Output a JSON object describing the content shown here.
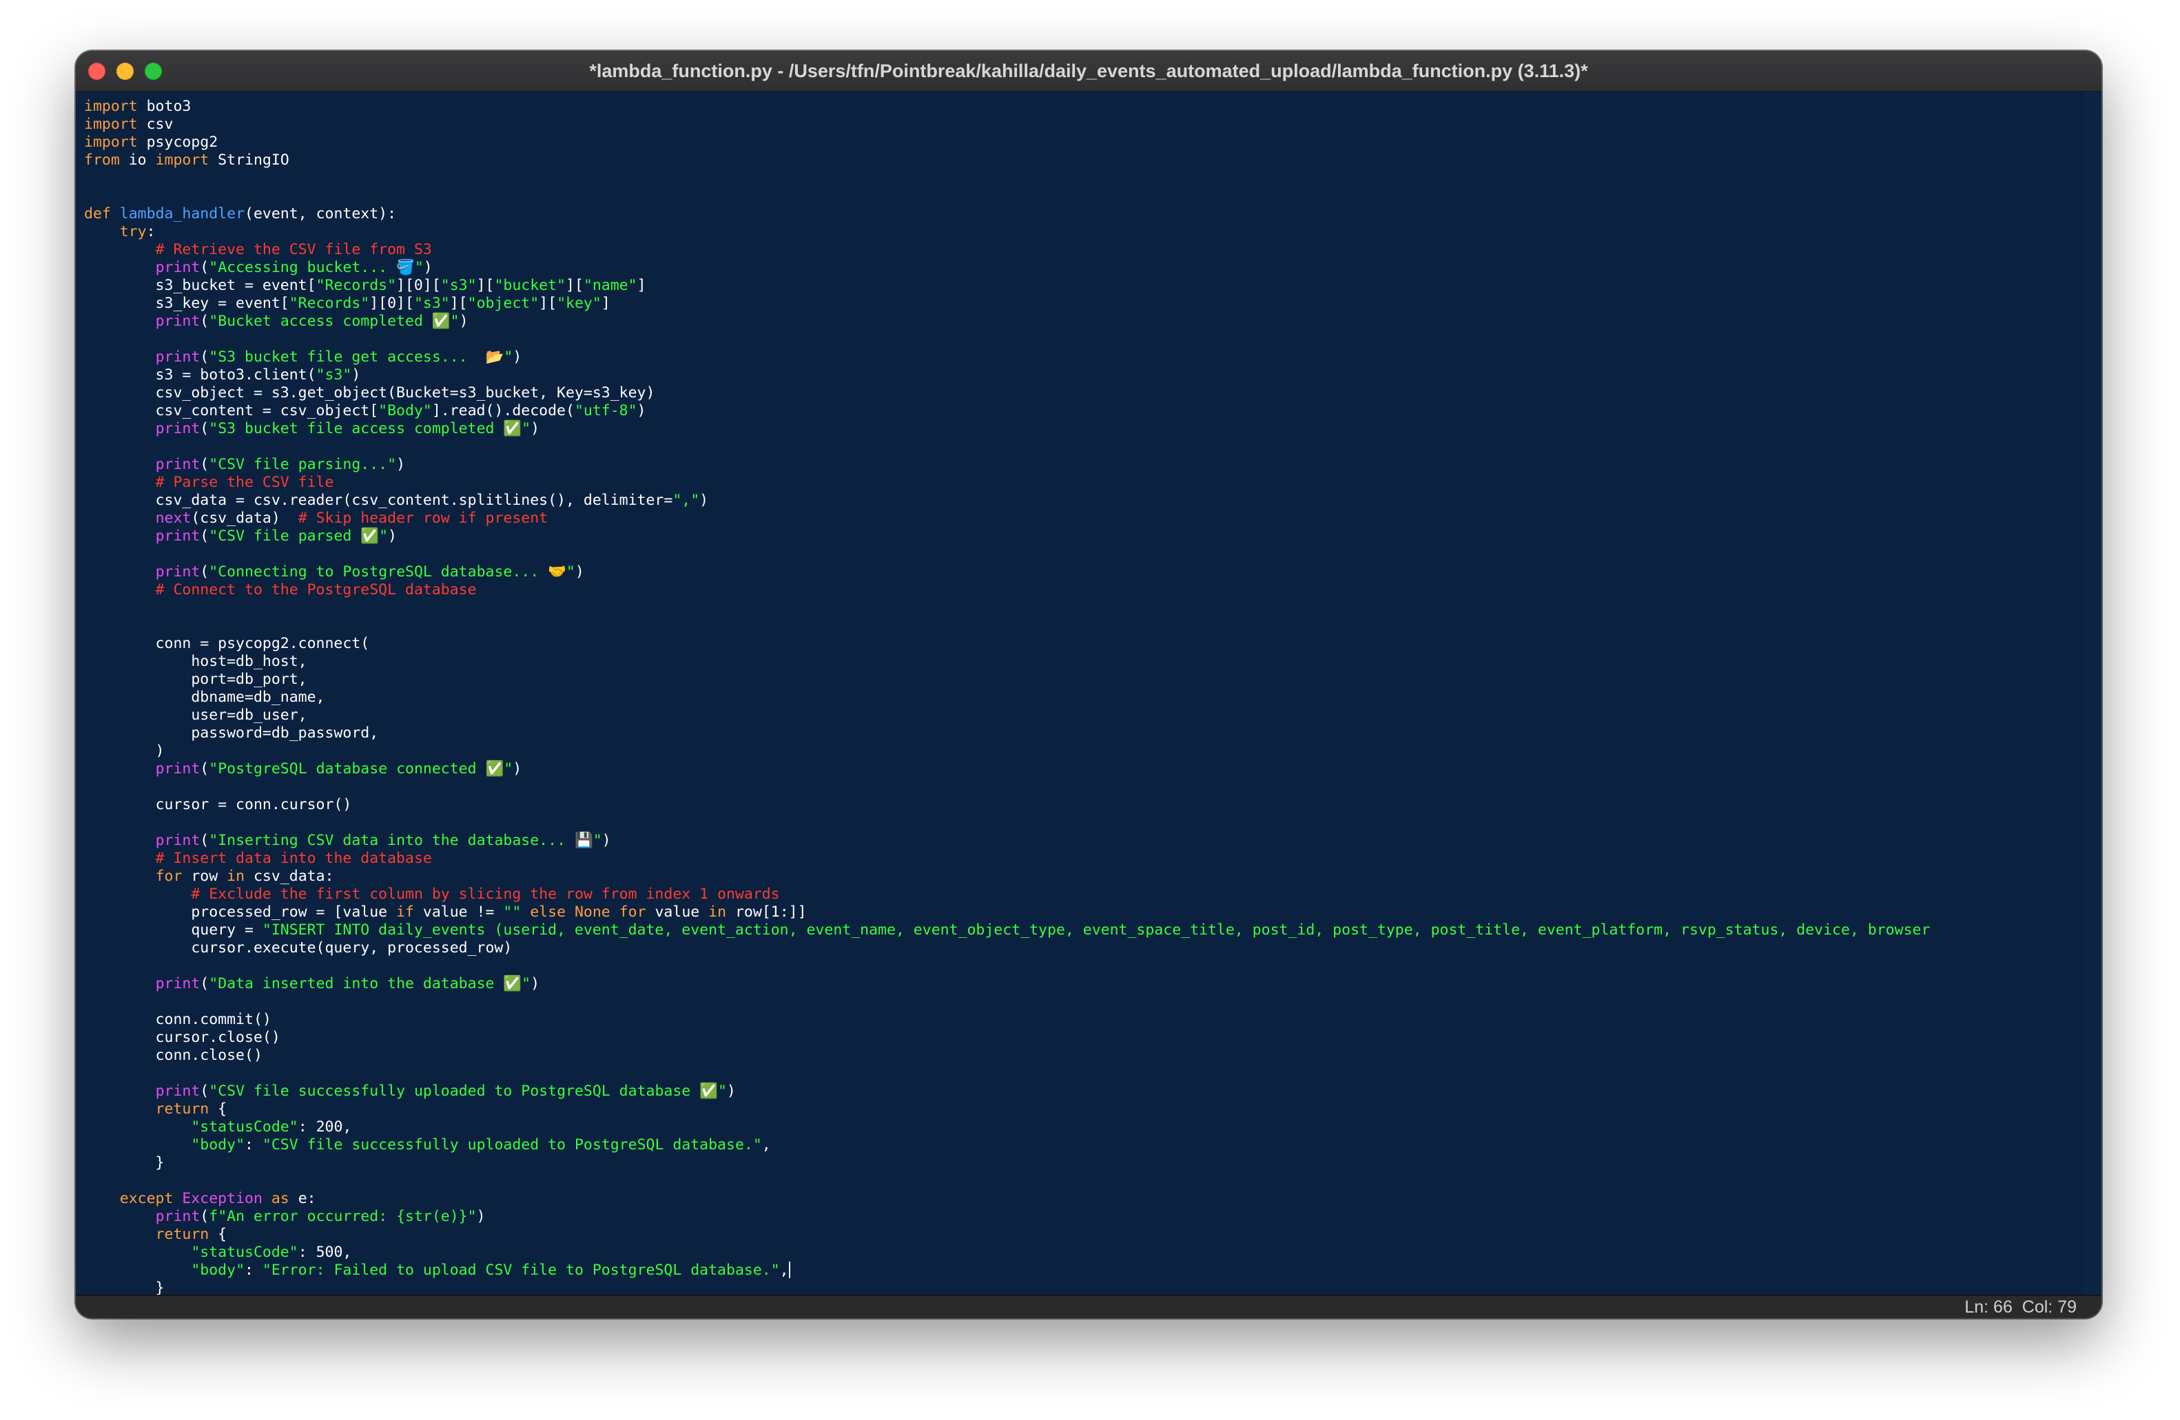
{
  "window": {
    "title": "*lambda_function.py - /Users/tfn/Pointbreak/kahilla/daily_events_automated_upload/lambda_function.py (3.11.3)*"
  },
  "status": {
    "ln": "Ln: 66",
    "col": "Col: 79"
  },
  "colors": {
    "background": "#0b2140",
    "keyword": "#ff9d3c",
    "builtin": "#e84cf0",
    "function": "#4fa3ff",
    "string": "#3bff3b",
    "comment": "#ff3b2e",
    "text": "#ffffff"
  },
  "code": [
    [
      [
        "t",
        "import"
      ],
      [
        "p",
        " boto3"
      ]
    ],
    [
      [
        "t",
        "import"
      ],
      [
        "p",
        " csv"
      ]
    ],
    [
      [
        "t",
        "import"
      ],
      [
        "p",
        " psycopg2"
      ]
    ],
    [
      [
        "t",
        "from"
      ],
      [
        "p",
        " io "
      ],
      [
        "t",
        "import"
      ],
      [
        "p",
        " StringIO"
      ]
    ],
    [],
    [],
    [
      [
        "t",
        "def"
      ],
      [
        "p",
        " "
      ],
      [
        "f",
        "lambda_handler"
      ],
      [
        "p",
        "(event, context):"
      ]
    ],
    [
      [
        "p",
        "    "
      ],
      [
        "t",
        "try"
      ],
      [
        "p",
        ":"
      ]
    ],
    [
      [
        "p",
        "        "
      ],
      [
        "c",
        "# Retrieve the CSV file from S3"
      ]
    ],
    [
      [
        "p",
        "        "
      ],
      [
        "b",
        "print"
      ],
      [
        "p",
        "("
      ],
      [
        "s",
        "\"Accessing bucket... 🪣\""
      ],
      [
        "p",
        ")"
      ]
    ],
    [
      [
        "p",
        "        s3_bucket = event["
      ],
      [
        "s",
        "\"Records\""
      ],
      [
        "p",
        "][0]["
      ],
      [
        "s",
        "\"s3\""
      ],
      [
        "p",
        "]["
      ],
      [
        "s",
        "\"bucket\""
      ],
      [
        "p",
        "]["
      ],
      [
        "s",
        "\"name\""
      ],
      [
        "p",
        "]"
      ]
    ],
    [
      [
        "p",
        "        s3_key = event["
      ],
      [
        "s",
        "\"Records\""
      ],
      [
        "p",
        "][0]["
      ],
      [
        "s",
        "\"s3\""
      ],
      [
        "p",
        "]["
      ],
      [
        "s",
        "\"object\""
      ],
      [
        "p",
        "]["
      ],
      [
        "s",
        "\"key\""
      ],
      [
        "p",
        "]"
      ]
    ],
    [
      [
        "p",
        "        "
      ],
      [
        "b",
        "print"
      ],
      [
        "p",
        "("
      ],
      [
        "s",
        "\"Bucket access completed ✅\""
      ],
      [
        "p",
        ")"
      ]
    ],
    [],
    [
      [
        "p",
        "        "
      ],
      [
        "b",
        "print"
      ],
      [
        "p",
        "("
      ],
      [
        "s",
        "\"S3 bucket file get access...  📂\""
      ],
      [
        "p",
        ")"
      ]
    ],
    [
      [
        "p",
        "        s3 = boto3.client("
      ],
      [
        "s",
        "\"s3\""
      ],
      [
        "p",
        ")"
      ]
    ],
    [
      [
        "p",
        "        csv_object = s3.get_object(Bucket=s3_bucket, Key=s3_key)"
      ]
    ],
    [
      [
        "p",
        "        csv_content = csv_object["
      ],
      [
        "s",
        "\"Body\""
      ],
      [
        "p",
        "].read().decode("
      ],
      [
        "s",
        "\"utf-8\""
      ],
      [
        "p",
        ")"
      ]
    ],
    [
      [
        "p",
        "        "
      ],
      [
        "b",
        "print"
      ],
      [
        "p",
        "("
      ],
      [
        "s",
        "\"S3 bucket file access completed ✅\""
      ],
      [
        "p",
        ")"
      ]
    ],
    [],
    [
      [
        "p",
        "        "
      ],
      [
        "b",
        "print"
      ],
      [
        "p",
        "("
      ],
      [
        "s",
        "\"CSV file parsing...\""
      ],
      [
        "p",
        ")"
      ]
    ],
    [
      [
        "p",
        "        "
      ],
      [
        "c",
        "# Parse the CSV file"
      ]
    ],
    [
      [
        "p",
        "        csv_data = csv.reader(csv_content.splitlines(), delimiter="
      ],
      [
        "s",
        "\",\""
      ],
      [
        "p",
        ")"
      ]
    ],
    [
      [
        "p",
        "        "
      ],
      [
        "b",
        "next"
      ],
      [
        "p",
        "(csv_data)  "
      ],
      [
        "c",
        "# Skip header row if present"
      ]
    ],
    [
      [
        "p",
        "        "
      ],
      [
        "b",
        "print"
      ],
      [
        "p",
        "("
      ],
      [
        "s",
        "\"CSV file parsed ✅\""
      ],
      [
        "p",
        ")"
      ]
    ],
    [],
    [
      [
        "p",
        "        "
      ],
      [
        "b",
        "print"
      ],
      [
        "p",
        "("
      ],
      [
        "s",
        "\"Connecting to PostgreSQL database... 🤝\""
      ],
      [
        "p",
        ")"
      ]
    ],
    [
      [
        "p",
        "        "
      ],
      [
        "c",
        "# Connect to the PostgreSQL database"
      ]
    ],
    [],
    [],
    [
      [
        "p",
        "        conn = psycopg2.connect("
      ]
    ],
    [
      [
        "p",
        "            host=db_host,"
      ]
    ],
    [
      [
        "p",
        "            port=db_port,"
      ]
    ],
    [
      [
        "p",
        "            dbname=db_name,"
      ]
    ],
    [
      [
        "p",
        "            user=db_user,"
      ]
    ],
    [
      [
        "p",
        "            password=db_password,"
      ]
    ],
    [
      [
        "p",
        "        )"
      ]
    ],
    [
      [
        "p",
        "        "
      ],
      [
        "b",
        "print"
      ],
      [
        "p",
        "("
      ],
      [
        "s",
        "\"PostgreSQL database connected ✅\""
      ],
      [
        "p",
        ")"
      ]
    ],
    [],
    [
      [
        "p",
        "        cursor = conn.cursor()"
      ]
    ],
    [],
    [
      [
        "p",
        "        "
      ],
      [
        "b",
        "print"
      ],
      [
        "p",
        "("
      ],
      [
        "s",
        "\"Inserting CSV data into the database... 💾\""
      ],
      [
        "p",
        ")"
      ]
    ],
    [
      [
        "p",
        "        "
      ],
      [
        "c",
        "# Insert data into the database"
      ]
    ],
    [
      [
        "p",
        "        "
      ],
      [
        "t",
        "for"
      ],
      [
        "p",
        " row "
      ],
      [
        "t",
        "in"
      ],
      [
        "p",
        " csv_data:"
      ]
    ],
    [
      [
        "p",
        "            "
      ],
      [
        "c",
        "# Exclude the first column by slicing the row from index 1 onwards"
      ]
    ],
    [
      [
        "p",
        "            processed_row = [value "
      ],
      [
        "t",
        "if"
      ],
      [
        "p",
        " value != "
      ],
      [
        "s",
        "\"\""
      ],
      [
        "p",
        " "
      ],
      [
        "t",
        "else"
      ],
      [
        "p",
        " "
      ],
      [
        "t",
        "None"
      ],
      [
        "p",
        " "
      ],
      [
        "t",
        "for"
      ],
      [
        "p",
        " value "
      ],
      [
        "t",
        "in"
      ],
      [
        "p",
        " row[1:]]"
      ]
    ],
    [
      [
        "p",
        "            query = "
      ],
      [
        "s",
        "\"INSERT INTO daily_events (userid, event_date, event_action, event_name, event_object_type, event_space_title, post_id, post_type, post_title, event_platform, rsvp_status, device, browser"
      ]
    ],
    [
      [
        "p",
        "            cursor.execute(query, processed_row)"
      ]
    ],
    [],
    [
      [
        "p",
        "        "
      ],
      [
        "b",
        "print"
      ],
      [
        "p",
        "("
      ],
      [
        "s",
        "\"Data inserted into the database ✅\""
      ],
      [
        "p",
        ")"
      ]
    ],
    [],
    [
      [
        "p",
        "        conn.commit()"
      ]
    ],
    [
      [
        "p",
        "        cursor.close()"
      ]
    ],
    [
      [
        "p",
        "        conn.close()"
      ]
    ],
    [],
    [
      [
        "p",
        "        "
      ],
      [
        "b",
        "print"
      ],
      [
        "p",
        "("
      ],
      [
        "s",
        "\"CSV file successfully uploaded to PostgreSQL database ✅\""
      ],
      [
        "p",
        ")"
      ]
    ],
    [
      [
        "p",
        "        "
      ],
      [
        "t",
        "return"
      ],
      [
        "p",
        " {"
      ]
    ],
    [
      [
        "p",
        "            "
      ],
      [
        "s",
        "\"statusCode\""
      ],
      [
        "p",
        ": 200,"
      ]
    ],
    [
      [
        "p",
        "            "
      ],
      [
        "s",
        "\"body\""
      ],
      [
        "p",
        ": "
      ],
      [
        "s",
        "\"CSV file successfully uploaded to PostgreSQL database.\""
      ],
      [
        "p",
        ","
      ]
    ],
    [
      [
        "p",
        "        }"
      ]
    ],
    [],
    [
      [
        "p",
        "    "
      ],
      [
        "t",
        "except"
      ],
      [
        "p",
        " "
      ],
      [
        "b",
        "Exception"
      ],
      [
        "p",
        " "
      ],
      [
        "t",
        "as"
      ],
      [
        "p",
        " e:"
      ]
    ],
    [
      [
        "p",
        "        "
      ],
      [
        "b",
        "print"
      ],
      [
        "p",
        "("
      ],
      [
        "s",
        "f\"An error occurred: {str(e)}\""
      ],
      [
        "p",
        ")"
      ]
    ],
    [
      [
        "p",
        "        "
      ],
      [
        "t",
        "return"
      ],
      [
        "p",
        " {"
      ]
    ],
    [
      [
        "p",
        "            "
      ],
      [
        "s",
        "\"statusCode\""
      ],
      [
        "p",
        ": 500,"
      ]
    ],
    [
      [
        "p",
        "            "
      ],
      [
        "s",
        "\"body\""
      ],
      [
        "p",
        ": "
      ],
      [
        "s",
        "\"Error: Failed to upload CSV file to PostgreSQL database.\""
      ],
      [
        "p",
        ","
      ],
      [
        "k",
        ""
      ]
    ],
    [
      [
        "p",
        "        }"
      ]
    ]
  ]
}
